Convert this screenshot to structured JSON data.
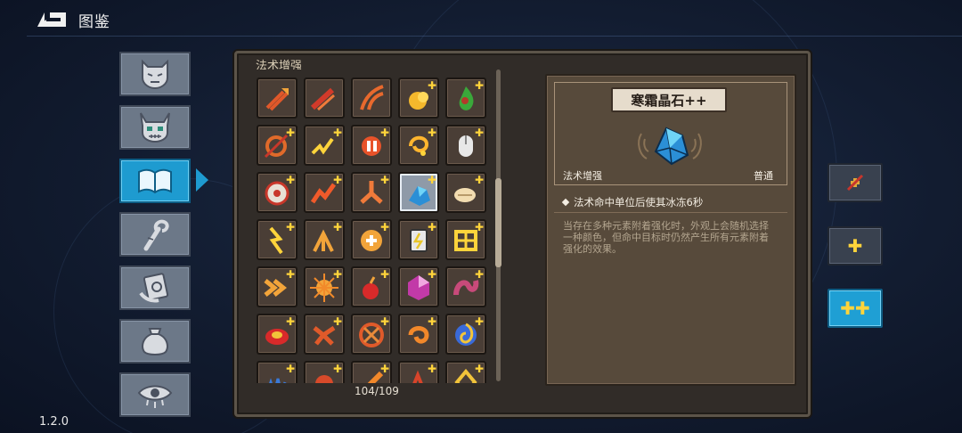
{
  "header": {
    "title": "图鉴",
    "version": "1.2.0"
  },
  "tabs": [
    {
      "icon": "demon-face-icon"
    },
    {
      "icon": "horned-skull-icon"
    },
    {
      "icon": "open-book-icon",
      "active": true
    },
    {
      "icon": "staff-icon"
    },
    {
      "icon": "hand-card-icon"
    },
    {
      "icon": "pouch-icon"
    },
    {
      "icon": "eye-icon"
    }
  ],
  "grid": {
    "section_label": "法术增强",
    "counter": "104/109",
    "selected_index": 13
  },
  "detail": {
    "name": "寒霜晶石++",
    "category": "法术增强",
    "rarity": "普通",
    "effect": "法术命中单位后使其冰冻6秒",
    "description": "当存在多种元素附着强化时，外观上会随机选择一种颜色，但命中目标时仍然产生所有元素附着强化的效果。"
  },
  "side_buttons": [
    {
      "label": "",
      "icon": "no-upgrade-icon"
    },
    {
      "label": "✚",
      "icon": "single-plus-icon"
    },
    {
      "label": "✚✚",
      "icon": "double-plus-icon",
      "active": true
    }
  ],
  "colors": {
    "accent": "#1e9bd0",
    "panel": "#312c28",
    "cell": "#4a3e36",
    "gold": "#ffd43b"
  }
}
